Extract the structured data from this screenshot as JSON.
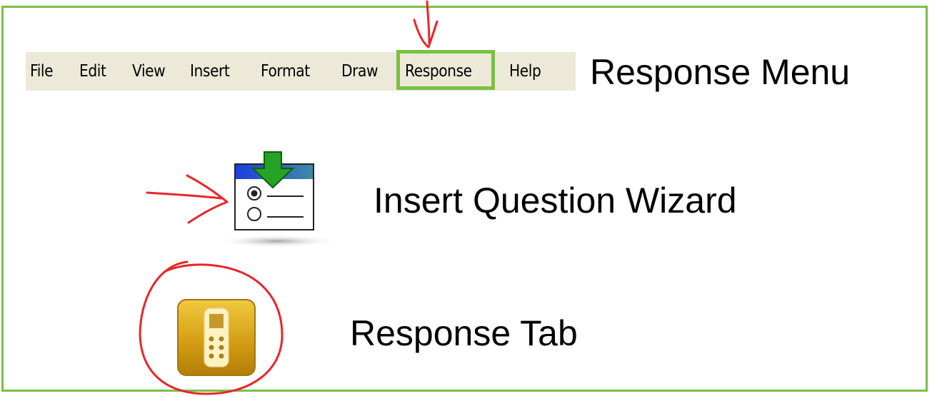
{
  "menu_bar": {
    "items": [
      {
        "label": "File"
      },
      {
        "label": "Edit"
      },
      {
        "label": "View"
      },
      {
        "label": "Insert"
      },
      {
        "label": "Format"
      },
      {
        "label": "Draw"
      },
      {
        "label": "Response",
        "highlighted": true
      },
      {
        "label": "Help"
      }
    ]
  },
  "captions": {
    "response_menu": "Response Menu",
    "insert_question_wizard": "Insert Question Wizard",
    "response_tab": "Response Tab"
  },
  "icons": {
    "wizard": "insert-question-wizard-icon",
    "tab": "response-tab-clicker-icon"
  },
  "colors": {
    "highlight_green": "#7ac143",
    "annotation_red": "#e8262a",
    "menubar_bg": "#ece9d8",
    "tab_gold": "#d4a21a"
  }
}
